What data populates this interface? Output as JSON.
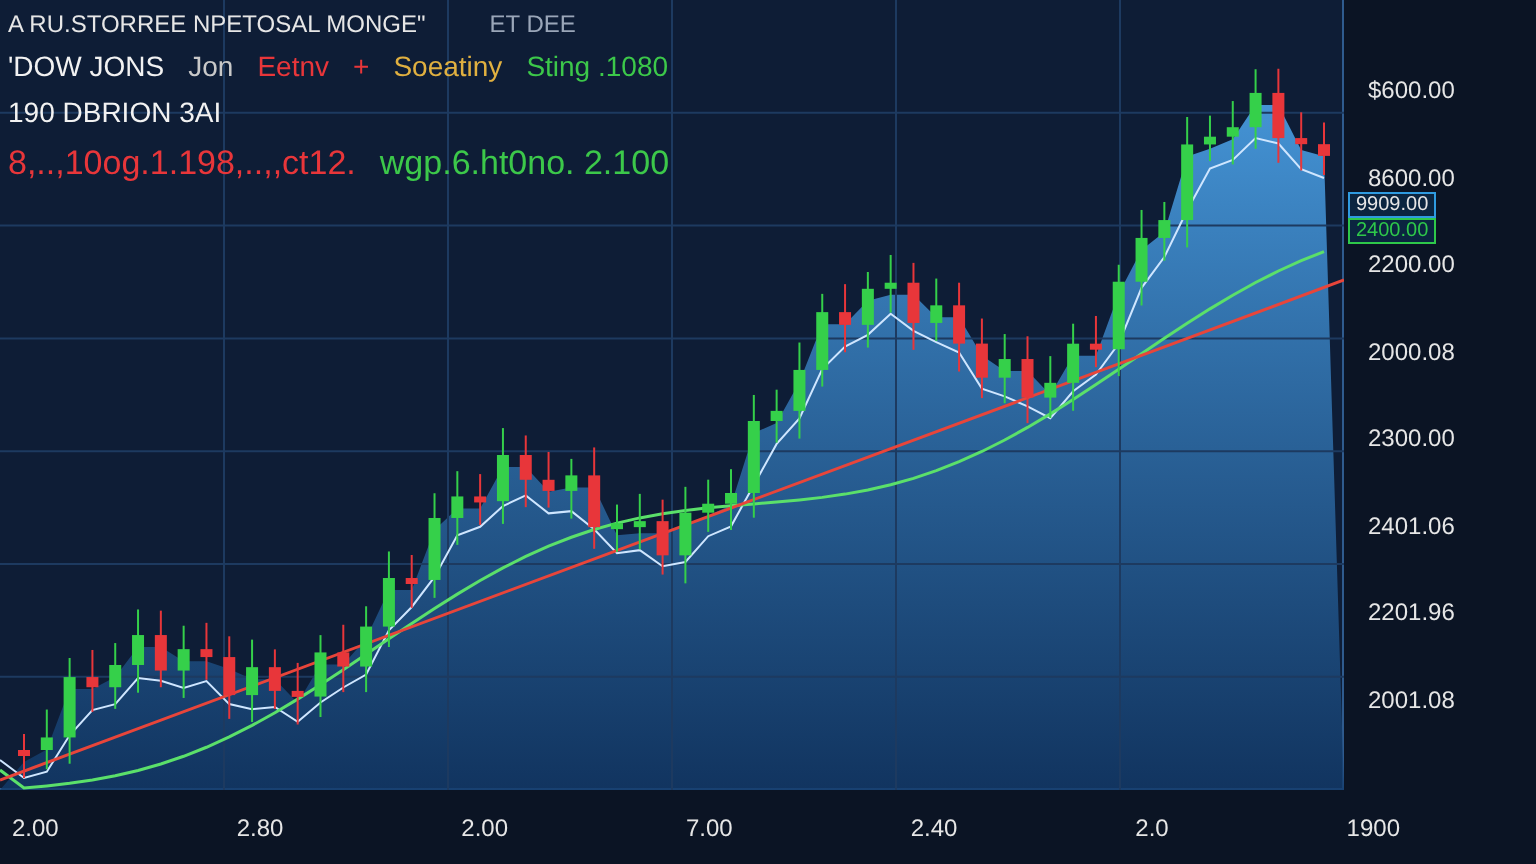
{
  "header": {
    "title": "A RU.STORREE NPETOSAL MONGE\"",
    "note": "ET DEE"
  },
  "quote_rows": [
    {
      "items": [
        {
          "text": "'DOW JONS",
          "color": "#f2f2f2"
        },
        {
          "text": "Jon",
          "color": "#c8c8c8"
        },
        {
          "text": "Eetnv",
          "color": "#e8363a"
        },
        {
          "text": "+",
          "color": "#e8363a"
        },
        {
          "text": "Soeatiny",
          "color": "#e0b040"
        },
        {
          "text": "Sting .1080",
          "color": "#3cc84a"
        }
      ]
    },
    {
      "items": [
        {
          "text": "190 DBRION 3AI",
          "color": "#f2f2f2"
        }
      ]
    },
    {
      "items": [
        {
          "text": "8,..,10og.1.198,..,,ct12.",
          "color": "#e8363a"
        },
        {
          "text": "wgp.6.ht0no. 2.100",
          "color": "#3cc84a"
        }
      ]
    }
  ],
  "y_axis": [
    "$600.00",
    "8600.00",
    "2200.00",
    "2000.08",
    "2300.00",
    "2401.06",
    "2201.96",
    "2001.08"
  ],
  "price_badges": [
    {
      "text": "9909.00",
      "color": "#2f9be0"
    },
    {
      "text": "2400.00",
      "color": "#2ec84a"
    }
  ],
  "x_axis": [
    "2.00",
    "2.80",
    "2.00",
    "7.00",
    "2.40",
    "2.0",
    "1900"
  ]
}
